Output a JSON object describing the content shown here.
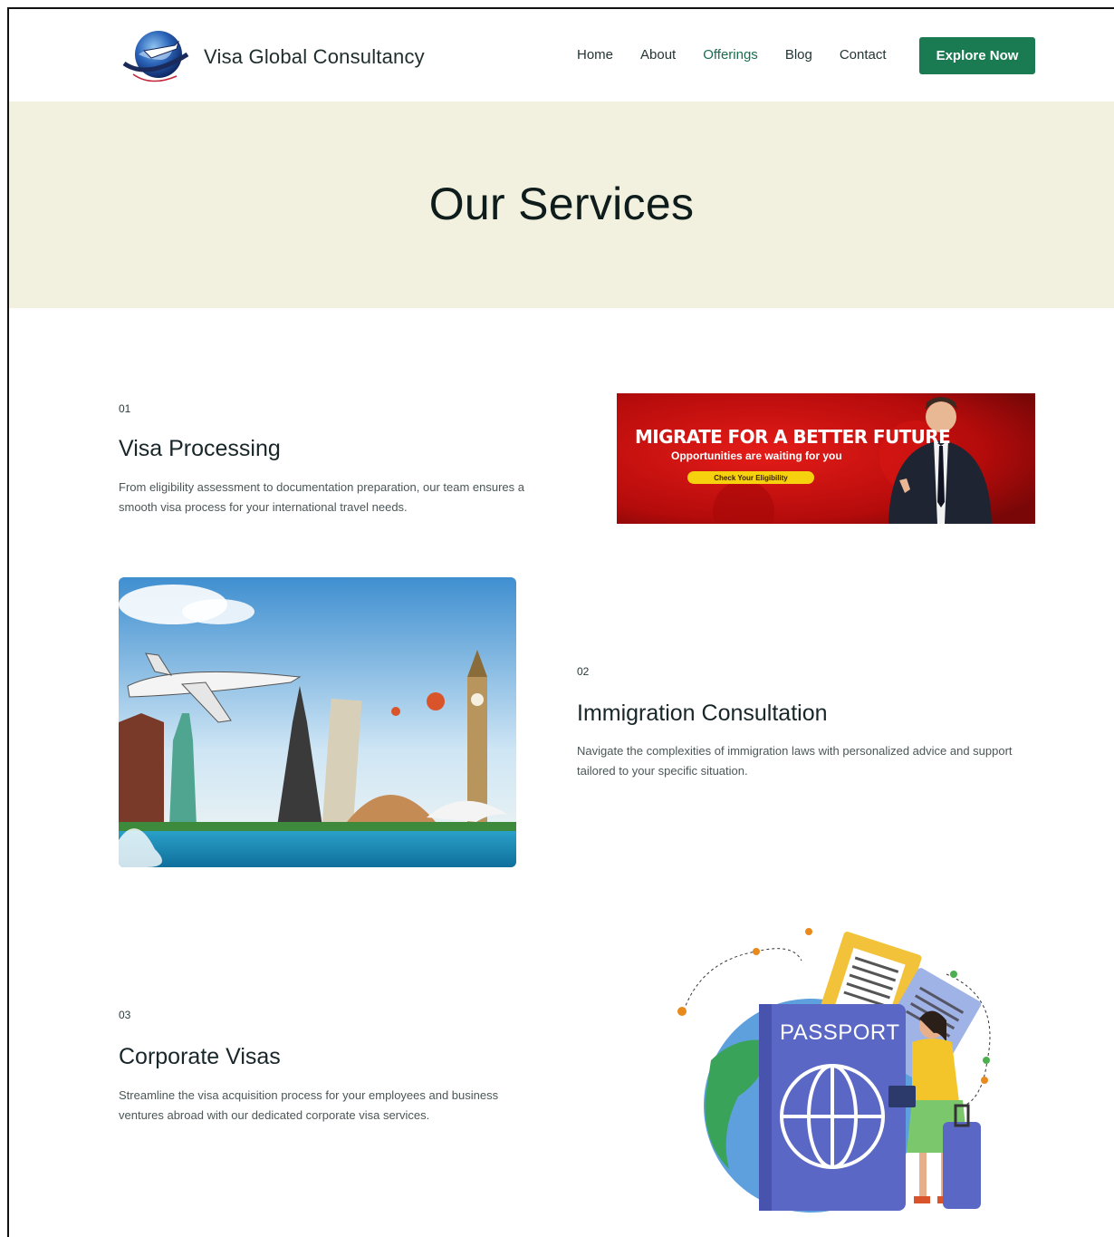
{
  "header": {
    "brand": "Visa Global Consultancy",
    "nav": [
      "Home",
      "About",
      "Offerings",
      "Blog",
      "Contact"
    ],
    "active_nav": "Offerings",
    "cta_label": "Explore Now"
  },
  "hero": {
    "title": "Our Services"
  },
  "services": [
    {
      "number": "01",
      "title": "Visa Processing",
      "description": "From eligibility assessment to documentation preparation, our team ensures a smooth visa process for your international travel needs."
    },
    {
      "number": "02",
      "title": "Immigration Consultation",
      "description": "Navigate the complexities of immigration laws with personalized advice and support tailored to your specific situation."
    },
    {
      "number": "03",
      "title": "Corporate Visas",
      "description": "Streamline the visa acquisition process for your employees and business ventures abroad with our dedicated corporate visa services."
    }
  ],
  "banner": {
    "headline": "MIGRATE FOR A BETTER FUTURE",
    "subline": "Opportunities are waiting for you",
    "button": "Check Your Eligibility"
  },
  "passport_art": {
    "label": "PASSPORT"
  },
  "colors": {
    "accent": "#1a7a52",
    "hero_bg": "#f2f1df",
    "banner_red": "#c8100e"
  }
}
